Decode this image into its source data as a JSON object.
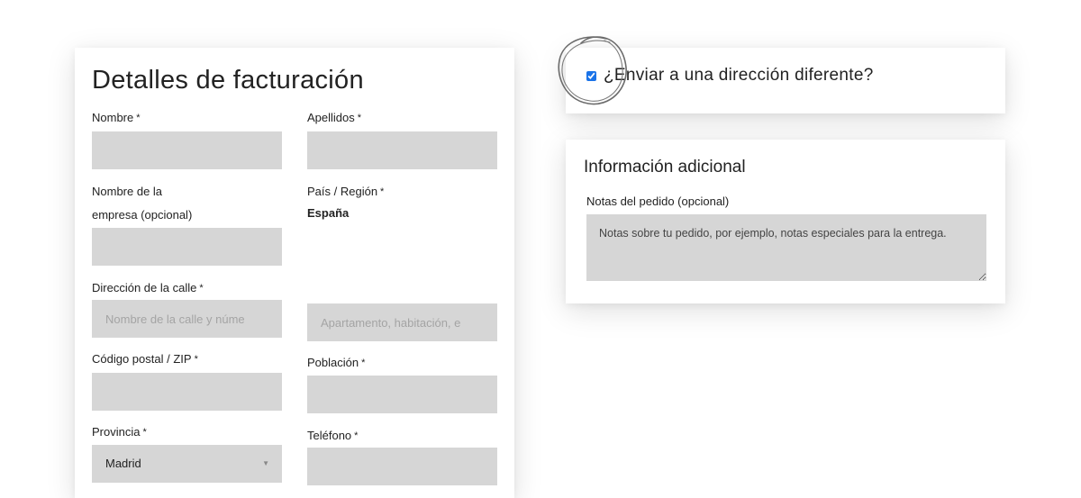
{
  "billing": {
    "title": "Detalles de facturación",
    "required_mark": "*",
    "first_name": {
      "label": "Nombre",
      "value": ""
    },
    "last_name": {
      "label": "Apellidos",
      "value": ""
    },
    "company": {
      "label_line1": "Nombre de la",
      "label_line2": "empresa (opcional)",
      "value": ""
    },
    "country": {
      "label": "País / Región",
      "value": "España"
    },
    "street": {
      "label": "Dirección de la calle",
      "placeholder_1": "Nombre de la calle y núme",
      "placeholder_2": "Apartamento, habitación, e"
    },
    "postcode": {
      "label": "Código postal / ZIP",
      "value": ""
    },
    "city": {
      "label": "Población",
      "value": ""
    },
    "province": {
      "label": "Provincia",
      "value": "Madrid",
      "chevron": "▼"
    },
    "phone": {
      "label": "Teléfono",
      "value": ""
    }
  },
  "shipping": {
    "checkbox_label": "¿Enviar a una dirección diferente?",
    "checked": true
  },
  "additional": {
    "title": "Información adicional",
    "notes_label": "Notas del pedido (opcional)",
    "notes_placeholder": "Notas sobre tu pedido, por ejemplo, notas especiales para la entrega."
  },
  "colors": {
    "field_bg": "#d6d6d6",
    "checkbox_accent": "#1a73e8",
    "scribble": "#6b6b6b"
  }
}
